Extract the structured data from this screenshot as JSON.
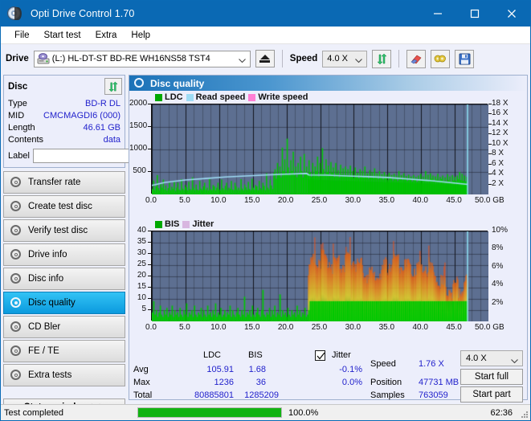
{
  "window": {
    "title": "Opti Drive Control 1.70",
    "minimize": "minimize-icon",
    "maximize": "maximize-icon",
    "close": "close-icon"
  },
  "menu": {
    "items": [
      "File",
      "Start test",
      "Extra",
      "Help"
    ]
  },
  "toolbar": {
    "drive_label": "Drive",
    "drive_value": "(L:)  HL-DT-ST BD-RE  WH16NS58 TST4",
    "eject": "eject-icon",
    "speed_label": "Speed",
    "speed_value": "4.0 X",
    "refresh": "refresh-icon",
    "eraser": "eraser-icon",
    "tools": "tools-icon",
    "save": "save-icon"
  },
  "disc": {
    "title": "Disc",
    "refresh": "refresh-icon",
    "rows": [
      {
        "key": "Type",
        "value": "BD-R DL"
      },
      {
        "key": "MID",
        "value": "CMCMAGDI6 (000)"
      },
      {
        "key": "Length",
        "value": "46.61 GB"
      },
      {
        "key": "Contents",
        "value": "data"
      }
    ],
    "label_key": "Label",
    "label_value": "",
    "label_button": "disc-label-icon"
  },
  "nav": {
    "items": [
      {
        "label": "Transfer rate",
        "active": false
      },
      {
        "label": "Create test disc",
        "active": false
      },
      {
        "label": "Verify test disc",
        "active": false
      },
      {
        "label": "Drive info",
        "active": false
      },
      {
        "label": "Disc info",
        "active": false
      },
      {
        "label": "Disc quality",
        "active": true
      },
      {
        "label": "CD Bler",
        "active": false
      },
      {
        "label": "FE / TE",
        "active": false
      },
      {
        "label": "Extra tests",
        "active": false
      }
    ],
    "status_window": "Status window > >"
  },
  "panel": {
    "title": "Disc quality"
  },
  "chart_data": [
    {
      "type": "bar",
      "id": "ldc-chart",
      "title": "",
      "xlabel": "GB",
      "ylabel": "",
      "legend": [
        {
          "label": "LDC",
          "color": "#00a800"
        },
        {
          "label": "Read speed",
          "color": "#9fdcf4"
        },
        {
          "label": "Write speed",
          "color": "#ff7fd4"
        }
      ],
      "x": [
        0.0,
        50.0
      ],
      "xticks": [
        "0.0",
        "5.0",
        "10.0",
        "15.0",
        "20.0",
        "25.0",
        "30.0",
        "35.0",
        "40.0",
        "45.0",
        "50.0"
      ],
      "ylim": [
        0,
        2000
      ],
      "yticks": [
        "500",
        "1000",
        "1500",
        "2000"
      ],
      "y2lim": [
        0,
        18
      ],
      "y2ticks": [
        "2 X",
        "4 X",
        "6 X",
        "8 X",
        "10 X",
        "12 X",
        "14 X",
        "16 X",
        "18 X"
      ],
      "grid": true,
      "data_end_gb": 46.9,
      "series": [
        {
          "name": "LDC",
          "color": "#00c800",
          "note": "error bars, dense spikes; low (~100-400) up to 23 GB, rising noisier band 400-1250 after 23 GB",
          "values": [
            120,
            310,
            95,
            180,
            430,
            140,
            90,
            250,
            150,
            330,
            110,
            200,
            85,
            140,
            260,
            95,
            170,
            120,
            300,
            80,
            150,
            260,
            110,
            90,
            340,
            130,
            95,
            210,
            160,
            90,
            280,
            120,
            100,
            380,
            150,
            95,
            220,
            110,
            90,
            300,
            130,
            95,
            180,
            260,
            100,
            150,
            90,
            340,
            120,
            95,
            210,
            180,
            90,
            150,
            260,
            110,
            95,
            330,
            140,
            100,
            190,
            260,
            95,
            150,
            120,
            300,
            110,
            95,
            260,
            180,
            100,
            150,
            95,
            340,
            130,
            90,
            220,
            160,
            100,
            280,
            120,
            95,
            350,
            150,
            100,
            210,
            180,
            95,
            300,
            140,
            100,
            260,
            190,
            95,
            470,
            150,
            110,
            330,
            200,
            120,
            480,
            560,
            350,
            700,
            440,
            620,
            380,
            1040,
            520,
            780,
            450,
            1240,
            600,
            430,
            760,
            520,
            950,
            430,
            620,
            380,
            700,
            450,
            840,
            520,
            380,
            900,
            470,
            620,
            430,
            760,
            500,
            390,
            700,
            450,
            620,
            520,
            840,
            400,
            700,
            470,
            1030,
            560,
            420,
            780,
            500,
            640,
            430,
            720,
            480,
            600,
            390,
            700,
            460,
            540,
            380,
            660,
            440,
            580,
            400,
            620,
            430,
            560,
            390,
            640,
            420,
            520,
            370,
            600,
            430,
            480,
            360,
            560,
            400,
            520,
            370,
            620,
            410,
            470,
            350,
            540,
            390,
            500,
            360,
            580,
            400,
            470,
            340,
            520,
            380,
            450,
            330,
            500,
            370,
            440,
            320,
            480,
            360,
            430,
            310,
            460,
            350,
            420,
            300,
            520,
            370,
            430,
            320,
            470,
            360,
            410,
            300,
            440,
            350,
            400,
            290,
            430,
            340,
            390,
            280,
            420,
            330,
            460,
            310,
            400,
            340,
            520,
            320,
            440,
            300,
            470,
            350,
            420,
            290,
            400,
            330,
            460,
            310,
            390,
            340,
            420,
            300,
            380,
            290,
            450,
            320,
            400,
            280,
            430,
            310,
            390,
            300,
            420,
            340,
            500,
            320,
            460,
            300,
            420,
            290,
            390
          ]
        },
        {
          "name": "Read speed",
          "color": "#9fdcf4",
          "note": "CAV ramp rising from ~2X at 0 GB to ~4.2X near 23 GB, then gently declining to ~2X at 46.9 GB",
          "points": [
            [
              0,
              1.8
            ],
            [
              2,
              2.4
            ],
            [
              5,
              2.9
            ],
            [
              8,
              3.2
            ],
            [
              11,
              3.5
            ],
            [
              14,
              3.7
            ],
            [
              17,
              3.9
            ],
            [
              20,
              4.05
            ],
            [
              23,
              4.2
            ],
            [
              23.3,
              3.9
            ],
            [
              26,
              3.85
            ],
            [
              29,
              3.7
            ],
            [
              32,
              3.55
            ],
            [
              35,
              3.4
            ],
            [
              38,
              3.1
            ],
            [
              41,
              2.8
            ],
            [
              44,
              2.4
            ],
            [
              46.9,
              2.0
            ]
          ]
        }
      ]
    },
    {
      "type": "bar",
      "id": "bis-jitter-chart",
      "title": "",
      "xlabel": "GB",
      "ylabel": "",
      "legend": [
        {
          "label": "BIS",
          "color": "#00a800"
        },
        {
          "label": "Jitter",
          "color": "#d8b6e0"
        }
      ],
      "x": [
        0.0,
        50.0
      ],
      "xticks": [
        "0.0",
        "5.0",
        "10.0",
        "15.0",
        "20.0",
        "25.0",
        "30.0",
        "35.0",
        "40.0",
        "45.0",
        "50.0"
      ],
      "ylim": [
        0,
        40
      ],
      "yticks": [
        "5",
        "10",
        "15",
        "20",
        "25",
        "30",
        "35",
        "40"
      ],
      "y2lim": [
        0,
        10
      ],
      "y2ticks": [
        "2%",
        "4%",
        "6%",
        "8%",
        "10%"
      ],
      "grid": true,
      "data_end_gb": 46.9,
      "series": [
        {
          "name": "BIS",
          "color": "#00c800",
          "note": "low ~2-5 up to 23 GB with occasional spikes to 10-14; after 23 GB overlaid by orange/yellow band",
          "values": [
            4,
            9,
            3,
            5,
            2,
            4,
            7,
            3,
            2,
            5,
            3,
            6,
            2,
            4,
            3,
            7,
            2,
            5,
            3,
            4,
            2,
            6,
            3,
            2,
            5,
            3,
            8,
            2,
            4,
            3,
            5,
            2,
            7,
            3,
            2,
            4,
            3,
            6,
            2,
            5,
            3,
            2,
            7,
            3,
            4,
            2,
            5,
            3,
            8,
            2,
            4,
            3,
            6,
            2,
            3,
            5,
            2,
            4,
            3,
            7,
            2,
            5,
            3,
            2,
            4,
            6,
            3,
            2,
            5,
            3,
            11,
            2,
            4,
            3,
            5,
            2,
            7,
            3,
            2,
            4,
            6,
            3,
            2,
            5,
            14,
            3,
            2,
            4,
            3,
            6,
            2,
            5,
            3,
            7,
            2,
            4,
            3,
            12,
            2,
            5,
            3,
            4,
            2,
            6,
            3,
            2,
            5,
            3,
            4,
            2,
            7,
            3,
            5,
            2,
            4,
            3,
            6,
            2,
            3,
            5,
            20,
            26,
            18,
            24,
            15,
            27,
            19,
            23,
            16,
            31,
            20,
            25,
            17,
            22,
            14,
            28,
            18,
            24,
            16,
            21,
            19,
            26,
            15,
            23,
            17,
            33,
            20,
            25,
            14,
            22,
            18,
            36,
            21,
            24,
            16,
            27,
            19,
            23,
            15,
            30,
            18,
            25,
            14,
            22,
            20,
            28,
            16,
            24,
            19,
            31,
            15,
            23,
            17,
            26,
            20,
            34,
            18,
            22,
            14,
            25,
            19,
            29,
            16,
            23,
            15,
            27,
            18,
            21,
            13,
            24,
            17,
            20,
            14,
            23,
            16,
            19,
            12,
            22,
            15,
            18,
            11,
            21,
            14,
            17,
            10,
            19,
            13,
            16,
            12,
            20,
            15,
            18,
            11,
            17,
            13,
            21,
            14,
            19,
            12,
            22,
            16,
            20,
            13,
            18,
            15,
            22,
            33,
            19,
            16,
            21,
            14,
            20,
            12,
            18,
            17,
            19,
            13,
            21,
            15,
            18
          ]
        },
        {
          "name": "Jitter",
          "color": "#f0a020",
          "note": "jitter band overlay; approx 4-8% range after 23 GB, shown orange/yellow"
        }
      ]
    }
  ],
  "stats": {
    "col_ldc": "LDC",
    "col_bis": "BIS",
    "rows": [
      {
        "label": "Avg",
        "ldc": "105.91",
        "bis": "1.68",
        "jitter": "-0.1%"
      },
      {
        "label": "Max",
        "ldc": "1236",
        "bis": "36",
        "jitter": "0.0%"
      },
      {
        "label": "Total",
        "ldc": "80885801",
        "bis": "1285209",
        "jitter": ""
      }
    ],
    "jitter_label": "Jitter",
    "jitter_checked": true,
    "speed_label": "Speed",
    "speed_value": "1.76 X",
    "position_label": "Position",
    "position_value": "47731 MB",
    "samples_label": "Samples",
    "samples_value": "763059",
    "speed_select": "4.0 X",
    "start_full": "Start full",
    "start_part": "Start part"
  },
  "statusbar": {
    "text": "Test completed",
    "progress_pct": 100.0,
    "progress_label": "100.0%",
    "elapsed": "62:36"
  }
}
